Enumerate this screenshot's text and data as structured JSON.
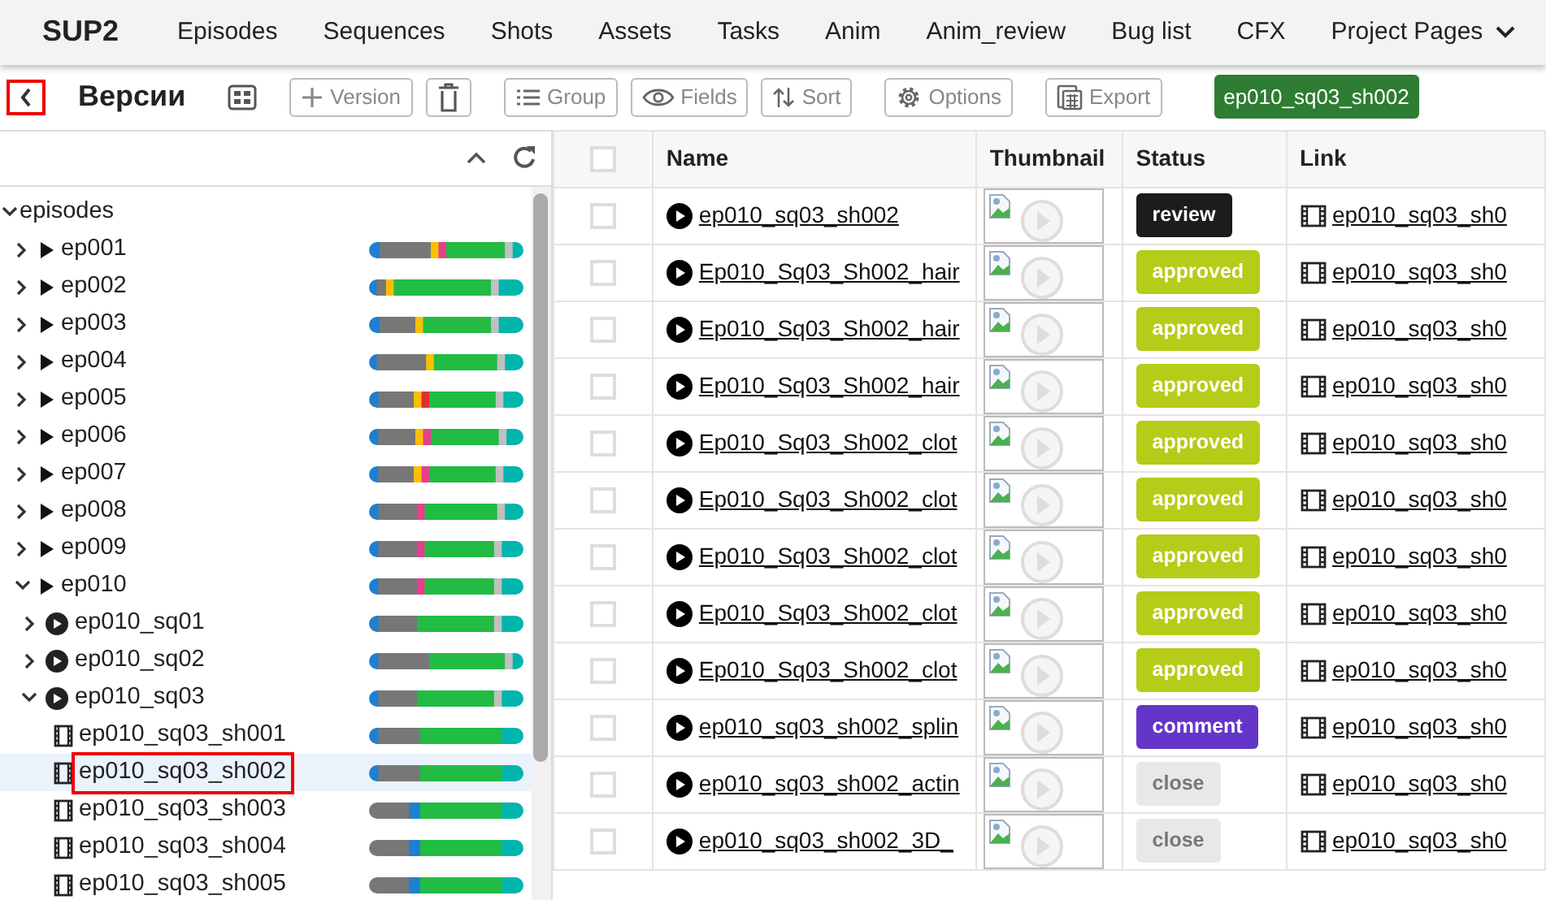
{
  "navbar": {
    "brand": "SUP2",
    "items": [
      {
        "label": "Episodes",
        "dropdown": false
      },
      {
        "label": "Sequences",
        "dropdown": false
      },
      {
        "label": "Shots",
        "dropdown": false
      },
      {
        "label": "Assets",
        "dropdown": false
      },
      {
        "label": "Tasks",
        "dropdown": false
      },
      {
        "label": "Anim",
        "dropdown": false
      },
      {
        "label": "Anim_review",
        "dropdown": false
      },
      {
        "label": "Bug list",
        "dropdown": false
      },
      {
        "label": "CFX",
        "dropdown": false
      },
      {
        "label": "Project Pages",
        "dropdown": true
      }
    ]
  },
  "toolbar": {
    "title": "Версии",
    "buttons": [
      {
        "kind": "grid"
      },
      {
        "kind": "add",
        "label": "Version"
      },
      {
        "kind": "delete"
      },
      {
        "kind": "group",
        "label": "Group"
      },
      {
        "kind": "fields",
        "label": "Fields"
      },
      {
        "kind": "sort",
        "label": "Sort"
      },
      {
        "kind": "options",
        "label": "Options"
      },
      {
        "kind": "export",
        "label": "Export"
      }
    ],
    "selected_item": "ep010_sq03_sh002"
  },
  "tree": [
    {
      "label": "episodes",
      "expanded": true,
      "selected": false,
      "children": [
        {
          "label": "ep001",
          "kind": "episode",
          "expanded": false,
          "selected": false
        },
        {
          "label": "ep002",
          "kind": "episode",
          "expanded": false,
          "selected": false
        },
        {
          "label": "ep003",
          "kind": "episode",
          "expanded": false,
          "selected": false
        },
        {
          "label": "ep004",
          "kind": "episode",
          "expanded": false,
          "selected": false
        },
        {
          "label": "ep005",
          "kind": "episode",
          "expanded": false,
          "selected": false
        },
        {
          "label": "ep006",
          "kind": "episode",
          "expanded": false,
          "selected": false
        },
        {
          "label": "ep007",
          "kind": "episode",
          "expanded": false,
          "selected": false
        },
        {
          "label": "ep008",
          "kind": "episode",
          "expanded": false,
          "selected": false
        },
        {
          "label": "ep009",
          "kind": "episode",
          "expanded": false,
          "selected": false
        },
        {
          "label": "ep010",
          "kind": "episode",
          "expanded": true,
          "selected": false,
          "children": [
            {
              "label": "ep010_sq01",
              "kind": "sequence",
              "expanded": false,
              "selected": false
            },
            {
              "label": "ep010_sq02",
              "kind": "sequence",
              "expanded": false,
              "selected": false
            },
            {
              "label": "ep010_sq03",
              "kind": "sequence",
              "expanded": true,
              "selected": false,
              "children": [
                {
                  "label": "ep010_sq03_sh001",
                  "kind": "shot",
                  "selected": false
                },
                {
                  "label": "ep010_sq03_sh002",
                  "kind": "shot",
                  "selected": true
                },
                {
                  "label": "ep010_sq03_sh003",
                  "kind": "shot",
                  "selected": false
                },
                {
                  "label": "ep010_sq03_sh004",
                  "kind": "shot",
                  "selected": false
                },
                {
                  "label": "ep010_sq03_sh005",
                  "kind": "shot",
                  "selected": false
                }
              ]
            }
          ]
        }
      ]
    }
  ],
  "table": {
    "columns": [
      "Name",
      "Thumbnail",
      "Status",
      "Link"
    ],
    "all_checked": false,
    "rows": [
      {
        "checked": false,
        "name": "ep010_sq03_sh002",
        "status": "review",
        "color": "#1b1c1d",
        "link": "ep010_sq03_sh0"
      },
      {
        "checked": false,
        "name": "Ep010_Sq03_Sh002_hair",
        "status": "approved",
        "color": "#b5cc18",
        "link": "ep010_sq03_sh0"
      },
      {
        "checked": false,
        "name": "Ep010_Sq03_Sh002_hair",
        "status": "approved",
        "color": "#b5cc18",
        "link": "ep010_sq03_sh0"
      },
      {
        "checked": false,
        "name": "Ep010_Sq03_Sh002_hair",
        "status": "approved",
        "color": "#b5cc18",
        "link": "ep010_sq03_sh0"
      },
      {
        "checked": false,
        "name": "Ep010_Sq03_Sh002_clot",
        "status": "approved",
        "color": "#b5cc18",
        "link": "ep010_sq03_sh0"
      },
      {
        "checked": false,
        "name": "Ep010_Sq03_Sh002_clot",
        "status": "approved",
        "color": "#b5cc18",
        "link": "ep010_sq03_sh0"
      },
      {
        "checked": false,
        "name": "Ep010_Sq03_Sh002_clot",
        "status": "approved",
        "color": "#b5cc18",
        "link": "ep010_sq03_sh0"
      },
      {
        "checked": false,
        "name": "Ep010_Sq03_Sh002_clot",
        "status": "approved",
        "color": "#b5cc18",
        "link": "ep010_sq03_sh0"
      },
      {
        "checked": false,
        "name": "Ep010_Sq03_Sh002_clot",
        "status": "approved",
        "color": "#b5cc18",
        "link": "ep010_sq03_sh0"
      },
      {
        "checked": false,
        "name": "ep010_sq03_sh002_splin",
        "status": "comment",
        "color": "#6435c9",
        "link": "ep010_sq03_sh0"
      },
      {
        "checked": false,
        "name": "ep010_sq03_sh002_actin",
        "status": "close",
        "color": "#e8e8e8",
        "link": "ep010_sq03_sh0"
      },
      {
        "checked": false,
        "name": "ep010_sq03_sh002_3D_",
        "status": "close",
        "color": "#e8e8e8",
        "link": "ep010_sq03_sh0"
      }
    ]
  }
}
